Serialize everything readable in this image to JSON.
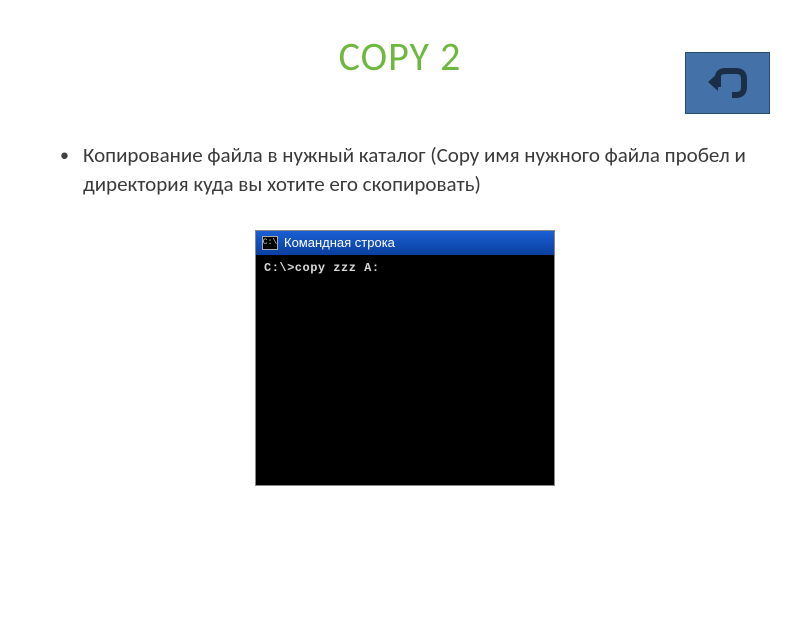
{
  "title": "COPY 2",
  "back": {
    "name": "back-button"
  },
  "bullet": {
    "text": "Копирование файла в нужный каталог (Copy имя нужного файла пробел и директория куда вы хотите его скопировать)"
  },
  "terminal": {
    "title": "Командная строка",
    "icon_text": "C:\\",
    "prompt_line": "C:\\>copy zzz A:"
  }
}
